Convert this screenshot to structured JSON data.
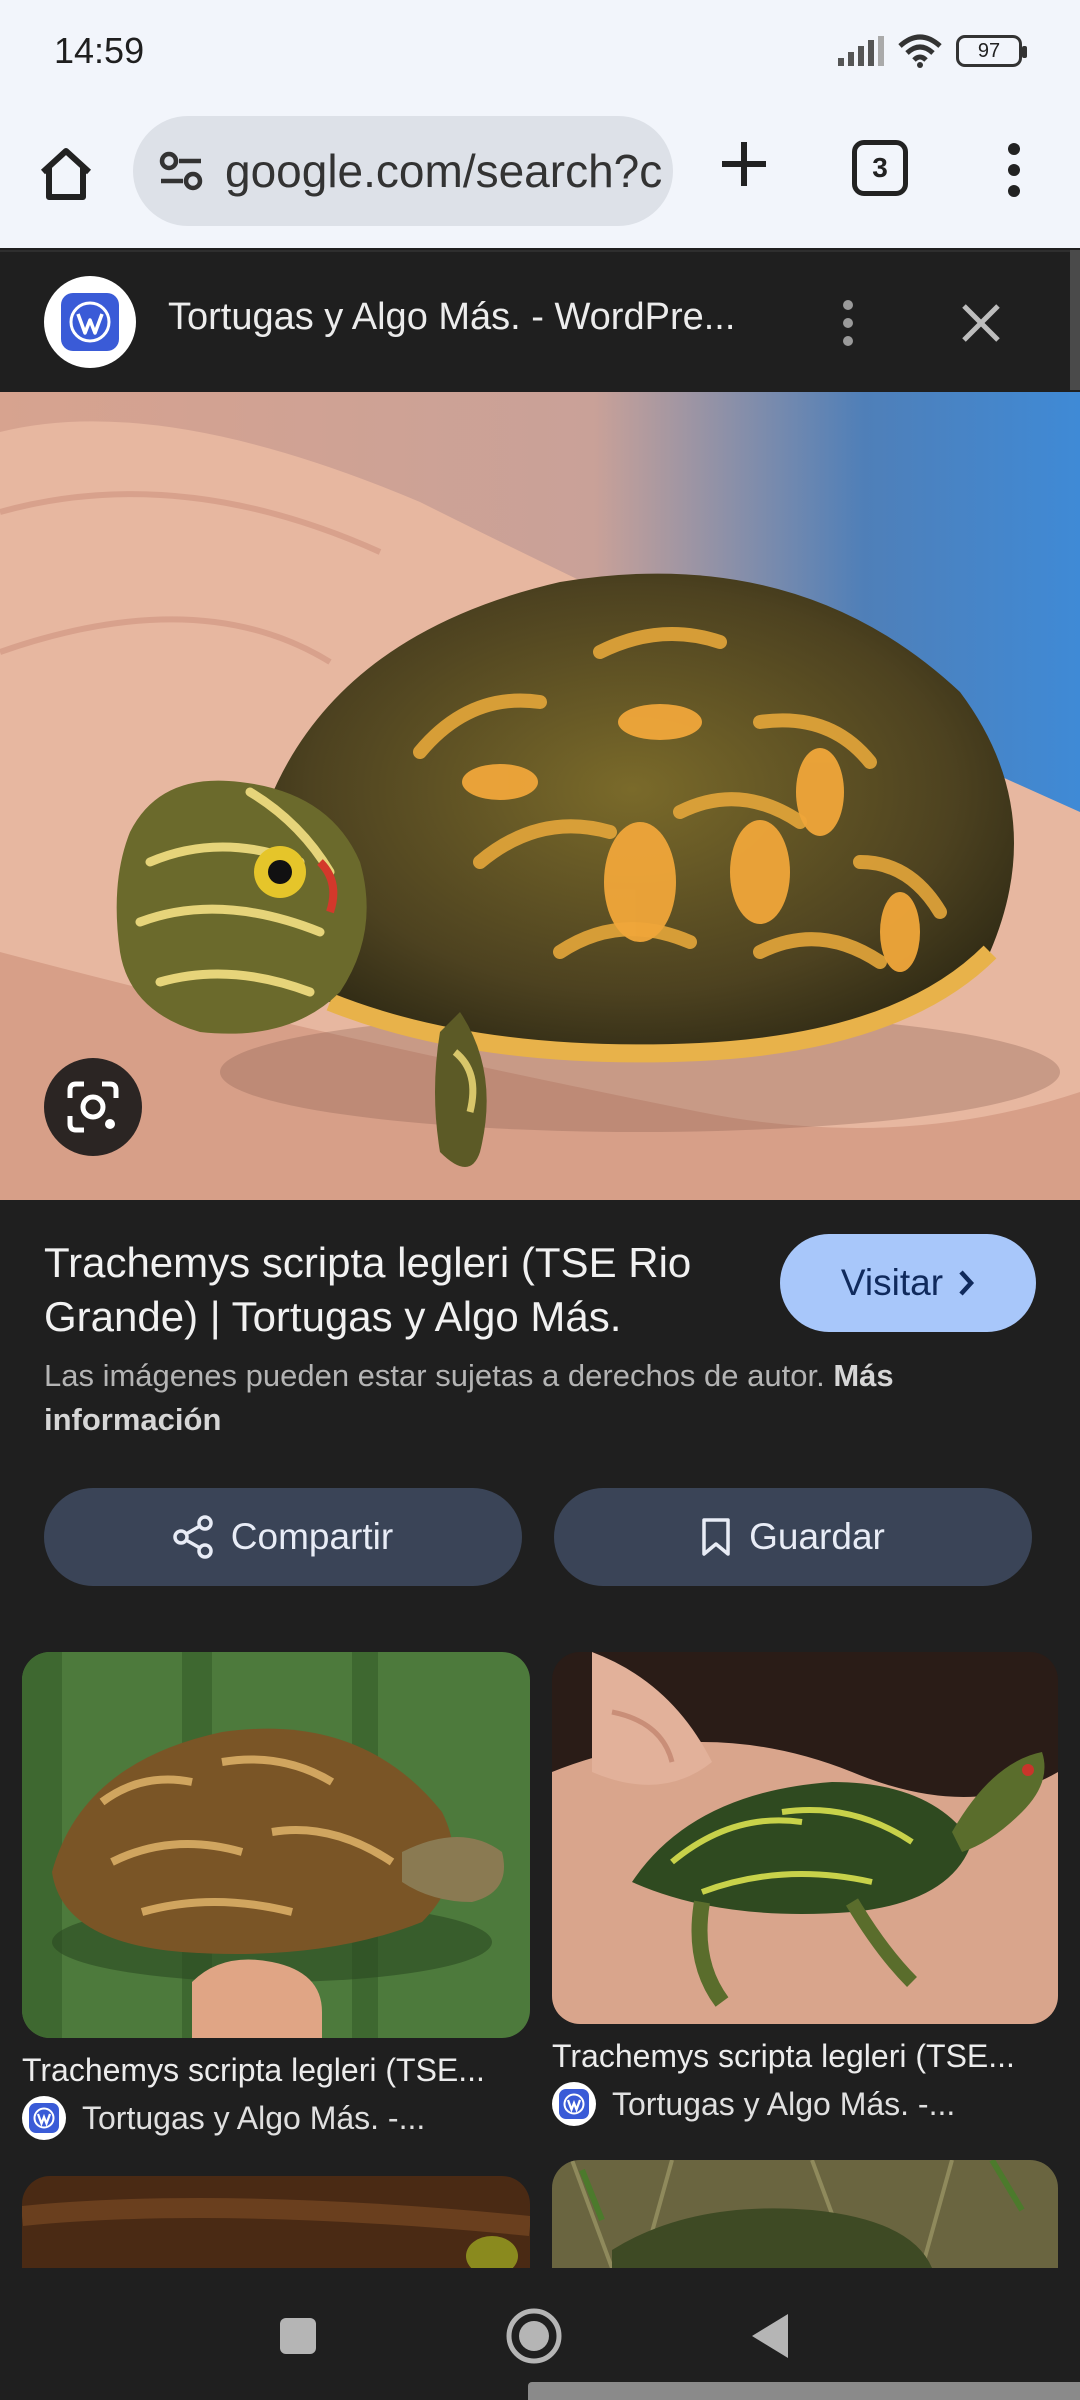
{
  "status_bar": {
    "time": "14:59",
    "battery": "97"
  },
  "toolbar": {
    "url": "google.com/search?c",
    "tab_count": "3"
  },
  "panel": {
    "site_title": "Tortugas y Algo Más. - WordPre..."
  },
  "result": {
    "title": "Trachemys scripta legleri (TSE Rio Grande) | Tortugas y Algo Más.",
    "visit_label": "Visitar",
    "copyright_text": "Las imágenes pueden estar sujetas a derechos de autor.",
    "more_info_label": "Más información",
    "share_label": "Compartir",
    "save_label": "Guardar"
  },
  "related": [
    {
      "caption": "Trachemys scripta legleri (TSE...",
      "source": "Tortugas y Algo Más. -..."
    },
    {
      "caption": "Trachemys scripta legleri (TSE...",
      "source": "Tortugas y Algo Más. -..."
    }
  ],
  "colors": {
    "accent": "#a8c7fa",
    "panel_background": "#1f1f1f",
    "browser_chrome": "#f2f5fb",
    "action_button": "#3a4457"
  },
  "icons": {
    "home": "home-icon",
    "tune": "site-info-icon",
    "new_tab": "plus-icon",
    "tabs": "tab-switcher-icon",
    "menu": "more-vert-icon",
    "close": "close-icon",
    "lens": "google-lens-icon",
    "share": "share-icon",
    "save": "bookmark-icon",
    "wordpress": "wordpress-icon"
  }
}
